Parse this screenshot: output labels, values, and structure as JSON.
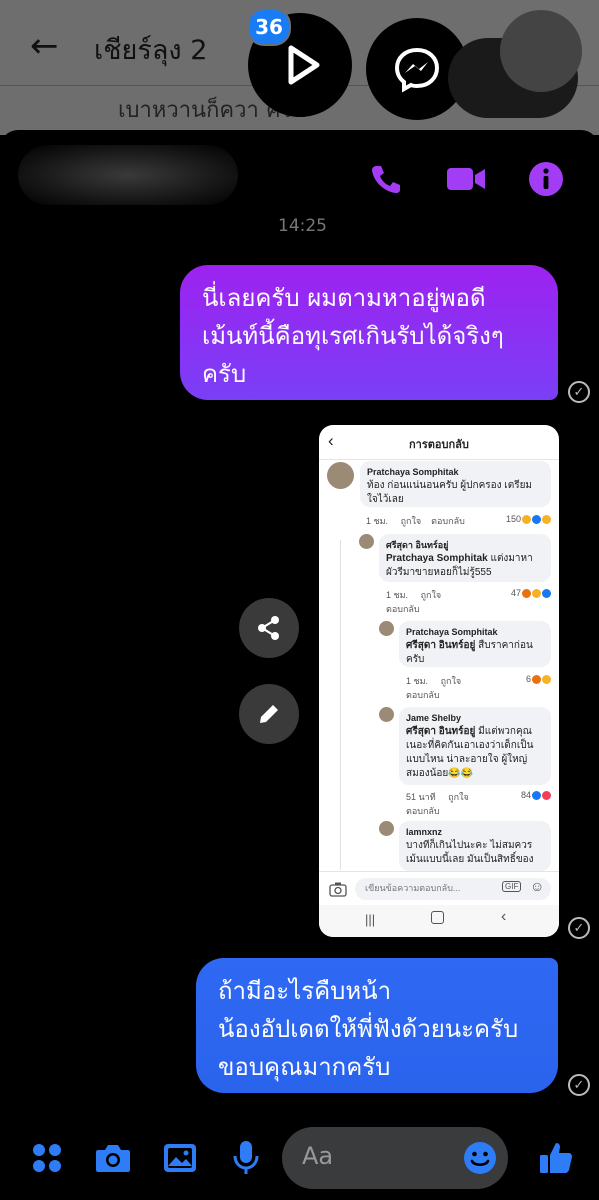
{
  "background_chat": {
    "back_arrow": "←",
    "title": "เชียร์ลุง 2",
    "preview_text": "เบาหวานก็ควา          ครับ"
  },
  "chat_heads": {
    "unread_badge": "36",
    "icons": [
      "play-icon",
      "messenger-icon"
    ]
  },
  "header": {
    "icons": [
      "phone-icon",
      "video-icon",
      "info-icon"
    ],
    "accent_color": "#a33cf5"
  },
  "timestamp": "14:25",
  "messages": [
    {
      "line1": "นี่เลยครับ ผมตามหาอยู่พอดี",
      "line2": "เม้นท์นี้คือทุเรศเกินรับได้จริงๆ",
      "line3": "ครับ"
    },
    {
      "line1": "ถ้ามีอะไรคืบหน้า",
      "line2": "น้องอัปเดตให้พี่ฟังด้วยนะครับ",
      "line3": "ขอบคุณมากครับ"
    }
  ],
  "shared_screenshot": {
    "title": "การตอบกลับ",
    "comments": [
      {
        "name": "Pratchaya Somphitak",
        "text1": "ท้อง ก่อนแน่นอนครับ ผู้ปกครอง เตรียม",
        "text2": "ใจไว้เลย",
        "time": "1 ชม.",
        "like": "ถูกใจ",
        "reply": "ตอบกลับ",
        "count": "150"
      },
      {
        "name": "ศรีสุดา อินทร์อยู่",
        "mention": "Pratchaya Somphitak",
        "text1": " แต่งมาหา",
        "text2": "ผัวรีมาขายหอยก็ไม่รู้555",
        "time": "1 ชม.",
        "like": "ถูกใจ",
        "reply": "ตอบกลับ",
        "count": "47"
      },
      {
        "name": "Pratchaya Somphitak",
        "mention": "ศรีสุดา อินทร์อยู่",
        "text1": " สืบราคาก่อน",
        "text2": "ครับ",
        "time": "1 ชม.",
        "like": "ถูกใจ",
        "reply": "ตอบกลับ",
        "count": "6"
      },
      {
        "name": "Jame Shelby",
        "mention": "ศรีสุดา อินทร์อยู่",
        "text1": " มีแต่พวกคุณ",
        "text2": "เนอะที่คิดกันเอาเองว่าเด็กเป็น",
        "text3": "แบบไหน น่าละอายใจ ผู้ใหญ่",
        "text4": "สมองน้อย😂😂",
        "time": "51 นาที",
        "like": "ถูกใจ",
        "reply": "ตอบกลับ",
        "count": "84"
      },
      {
        "name": "lamnxnz",
        "text1": "บางทีก็เกินไปนะคะ ไม่สมควร",
        "text2": "เม้นแบบนี้เลย มันเป็นสิทธิ์ของ"
      }
    ],
    "input_placeholder": "เขียนข้อความตอบกลับ...",
    "gif_label": "GIF"
  },
  "composer": {
    "placeholder": "Aa",
    "icons": [
      "apps-icon",
      "camera-icon",
      "gallery-icon",
      "mic-icon",
      "emoji-icon",
      "like-icon"
    ],
    "accent_color": "#2e7cf6"
  }
}
